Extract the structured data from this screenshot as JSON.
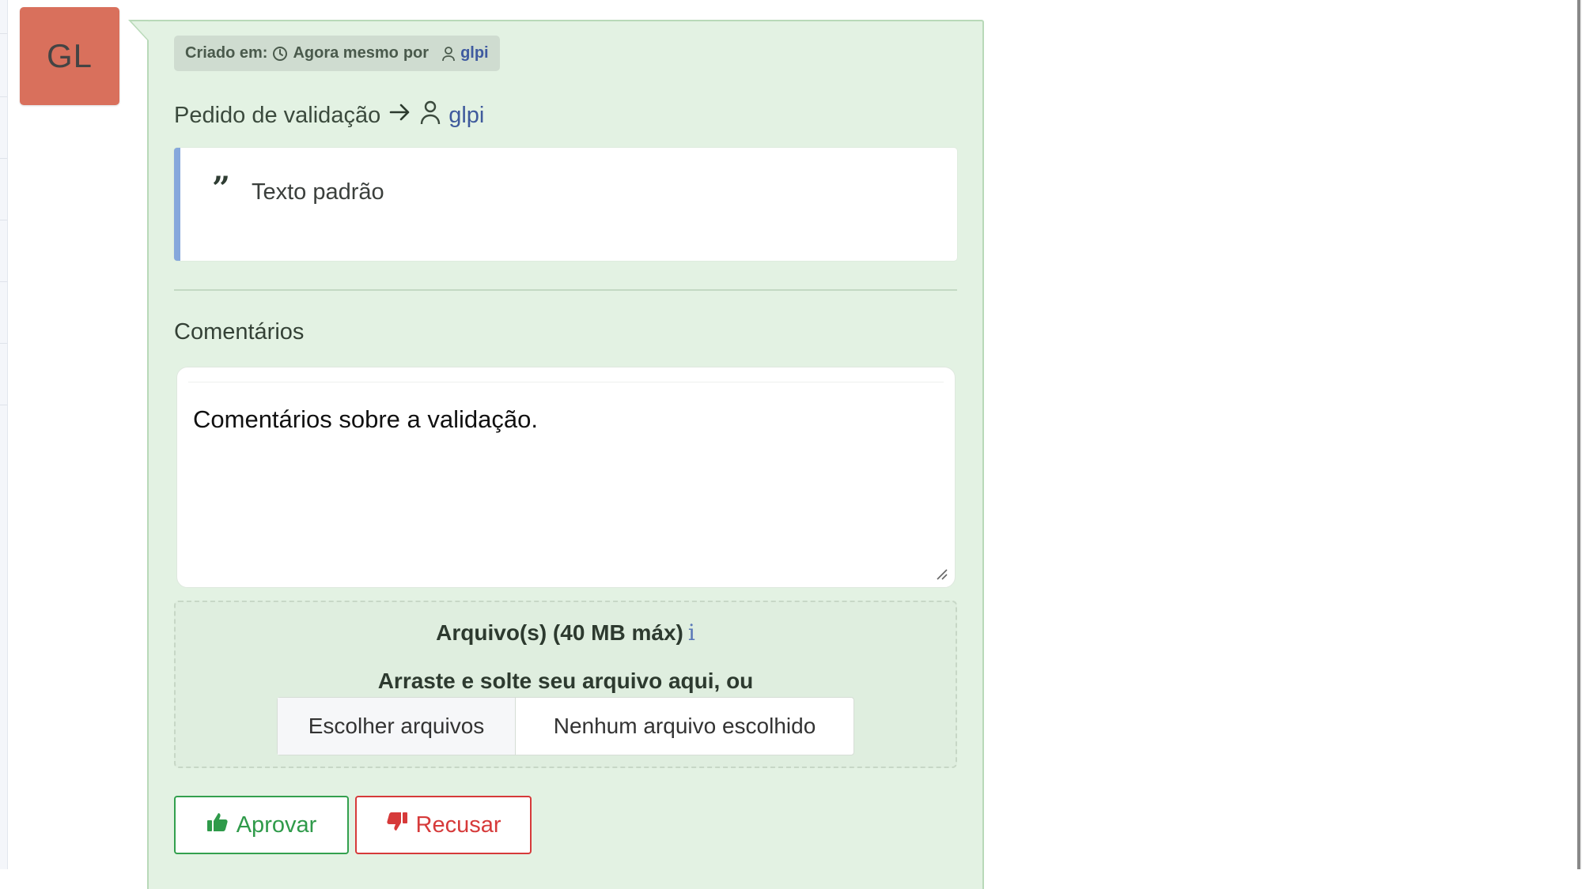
{
  "avatar": {
    "initials": "GL",
    "color": "#d9705c"
  },
  "meta": {
    "created_label": "Criado em:",
    "time": "Agora mesmo",
    "by_label": "por",
    "user": "glpi"
  },
  "request": {
    "label": "Pedido de validação",
    "user": "glpi"
  },
  "quote": {
    "text": "Texto padrão"
  },
  "comments": {
    "label": "Comentários",
    "value": "Comentários sobre a validação."
  },
  "upload": {
    "title": "Arquivo(s) (40 MB máx)",
    "info_glyph": "i",
    "hint": "Arraste e solte seu arquivo aqui, ou",
    "choose_label": "Escolher arquivos",
    "no_file_label": "Nenhum arquivo escolhido"
  },
  "actions": {
    "approve_label": "Aprovar",
    "reject_label": "Recusar"
  },
  "icons": {
    "clock": "clock-icon",
    "user": "user-icon",
    "arrow": "arrow-right-icon",
    "quote": "quote-icon",
    "thumbs_up": "thumbs-up-icon",
    "thumbs_down": "thumbs-down-icon",
    "info": "info-icon"
  },
  "colors": {
    "card_bg": "#e3f2e3",
    "card_border": "#b8d9b8",
    "approve": "#2f9a4a",
    "reject": "#d63a3a",
    "quote_border": "#86a8dc",
    "link": "#3f5aa0"
  }
}
